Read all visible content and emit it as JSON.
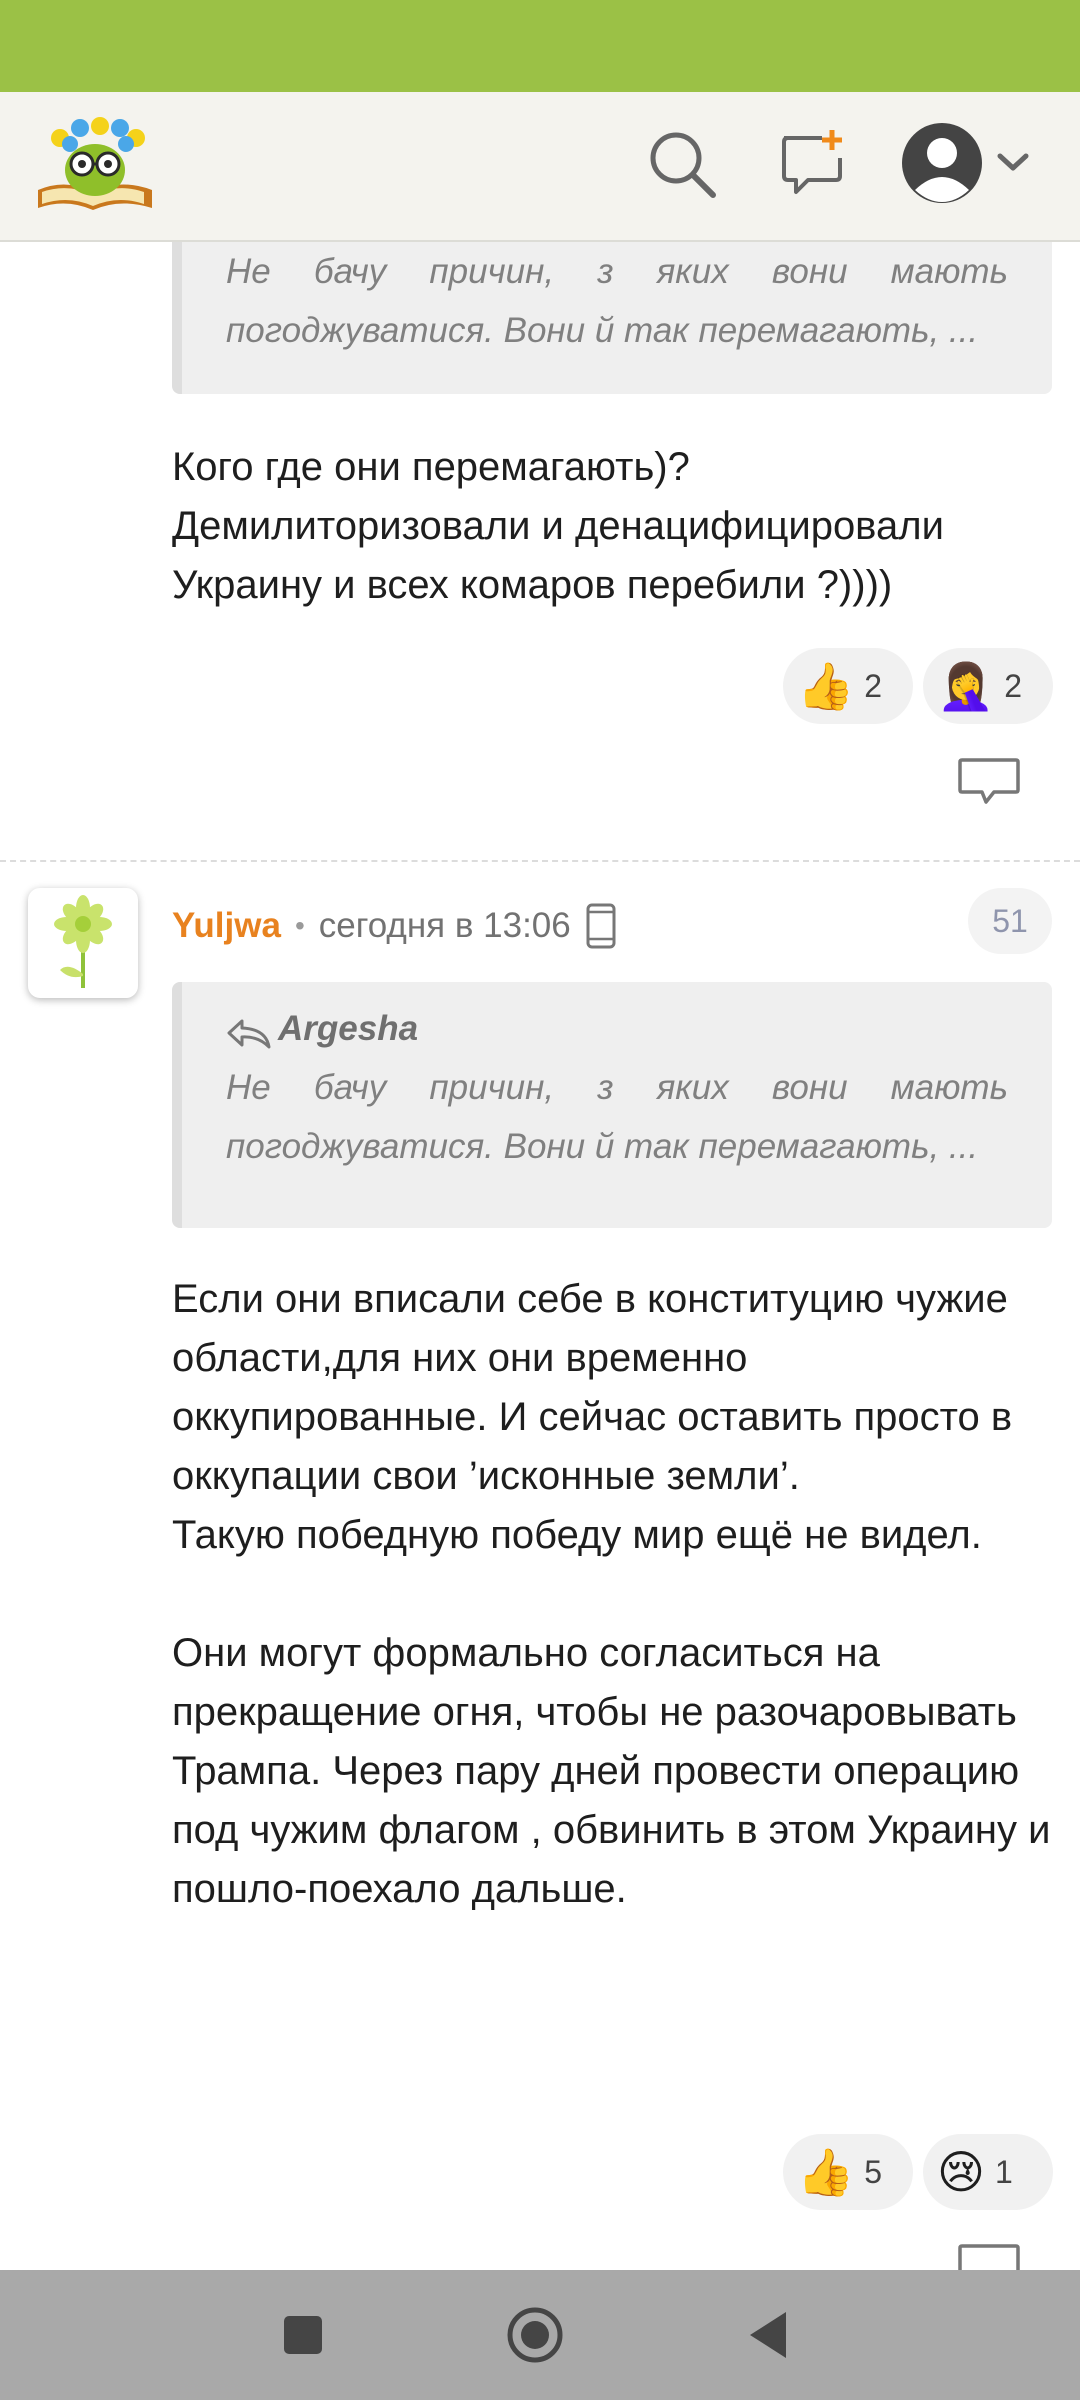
{
  "colors": {
    "status_bar": "#9bc146",
    "header_bg": "#f4f3ee",
    "username": "#e8821f",
    "nav_bar": "#a9a9a9"
  },
  "header": {
    "icons": [
      "logo-icon",
      "search-icon",
      "new-post-icon",
      "user-avatar-icon",
      "chevron-down-icon"
    ]
  },
  "comment_prev": {
    "quote_text": "Не бачу причин, з яких вони мають погоджуватися. Вони й так перемагають, ...",
    "text": "Кого где они перемагають)?\nДемилиторизовали и денацифицировали Украину и всех комаров перебили ?))))",
    "reactions": [
      {
        "emoji": "👍",
        "count": "2"
      },
      {
        "emoji": "🤦‍♀️",
        "count": "2"
      }
    ]
  },
  "comment": {
    "username": "Yuljwa",
    "separator": "•",
    "time": "сегодня в 13:06",
    "number": "51",
    "quote_author": "Argesha",
    "quote_text": "Не бачу причин, з яких вони мають погоджуватися. Вони й так перемагають, ...",
    "text": "Если они вписали себе в конституцию чужие области,для них они временно оккупированные. И сейчас оставить просто в оккупации свои ’исконные земли’.\nТакую победную победу мир ещё не видел.\n\nОни могут формально согласиться на прекращение огня, чтобы не разочаровывать Трампа. Через пару дней провести операцию под чужим флагом , обвинить в этом Украину и пошло-поехало дальше.",
    "reactions": [
      {
        "emoji": "👍",
        "count": "5"
      },
      {
        "emoji": "😢",
        "count": "1"
      }
    ]
  },
  "nav": {
    "icons": [
      "recent-apps-icon",
      "home-icon",
      "back-icon"
    ]
  }
}
